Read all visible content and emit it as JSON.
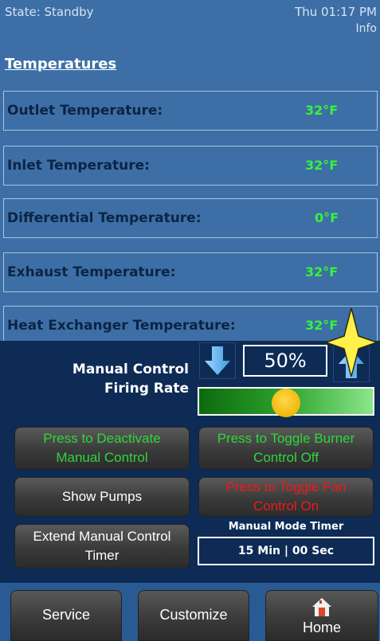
{
  "header": {
    "state": "State: Standby",
    "datetime": "Thu 01:17 PM",
    "info": "Info"
  },
  "temperatures": {
    "title": "Temperatures",
    "rows": [
      {
        "label": "Outlet Temperature:",
        "value": "32°F"
      },
      {
        "label": "Inlet Temperature:",
        "value": "32°F"
      },
      {
        "label": "Differential Temperature:",
        "value": "0°F"
      },
      {
        "label": "Exhaust Temperature:",
        "value": "32°F"
      },
      {
        "label": "Heat Exchanger Temperature:",
        "value": "32°F"
      }
    ]
  },
  "manual_control": {
    "label_line1": "Manual Control",
    "label_line2": "Firing Rate",
    "rate_text": "50%",
    "slider_level": 0.5
  },
  "buttons": {
    "deactivate_manual": {
      "line1": "Press to Deactivate",
      "line2": "Manual Control"
    },
    "toggle_burner": {
      "line1": "Press to Toggle Burner",
      "line2": "Control Off"
    },
    "show_pumps": "Show Pumps",
    "toggle_fan": {
      "line1": "Press to Toggle Fan",
      "line2": "Control On"
    },
    "extend_timer": {
      "line1": "Extend Manual Control",
      "line2": "Timer"
    }
  },
  "timer": {
    "title": "Manual Mode Timer",
    "value": "15 Min | 00 Sec"
  },
  "nav": {
    "service": "Service",
    "customize": "Customize",
    "home": "Home"
  },
  "colors": {
    "value_green": "#37f23a",
    "active_green": "#2fd63a",
    "alert_red": "#ee1a1a",
    "panel_blue": "#3d6fa6",
    "dark_navy": "#0d2b55"
  },
  "icons": {
    "down_arrow": "arrow-down-icon",
    "up_arrow": "arrow-up-icon",
    "home": "home-icon",
    "cursor": "star-cursor-icon"
  }
}
